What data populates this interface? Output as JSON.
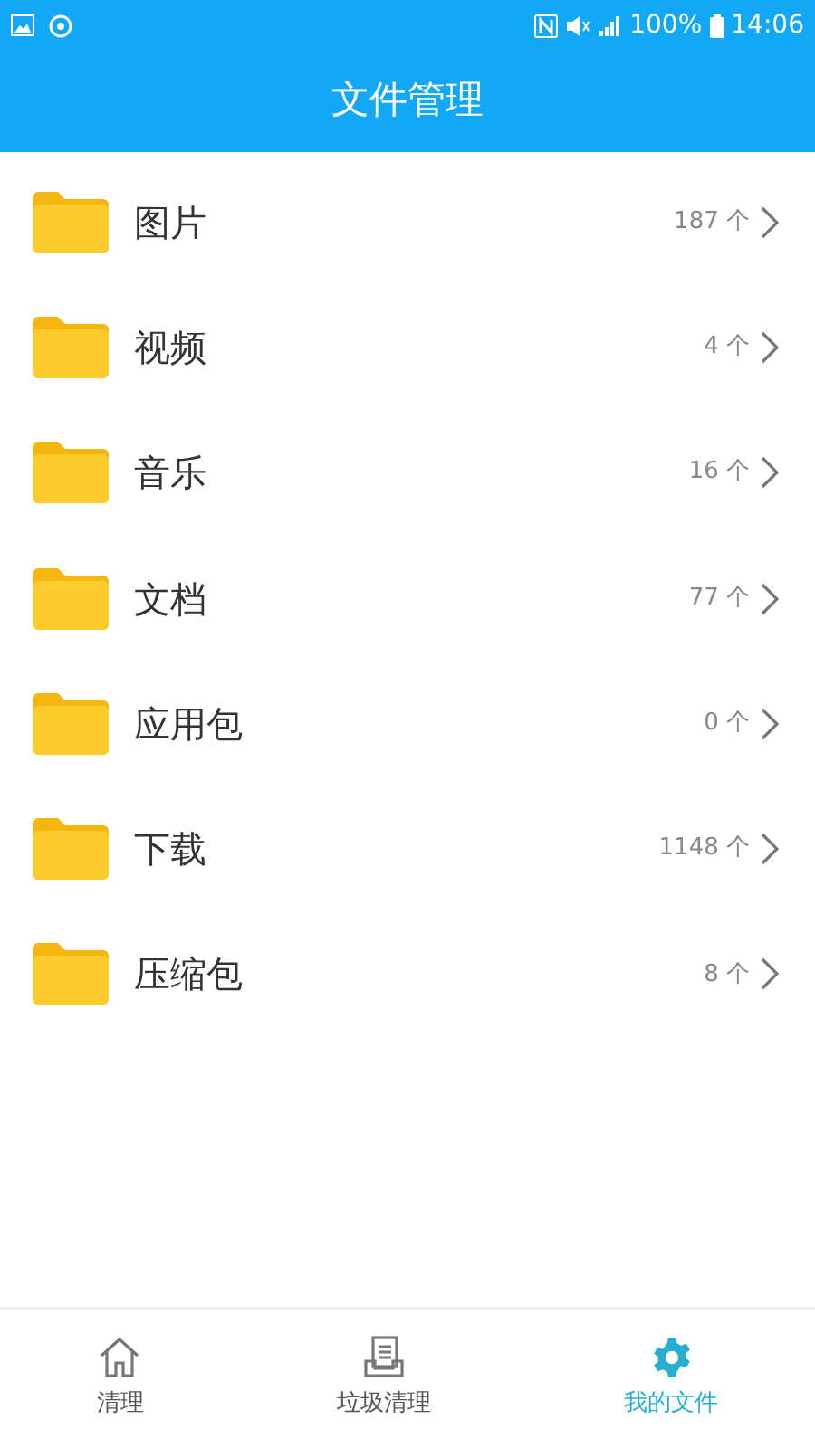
{
  "status_bar": {
    "battery": "100%",
    "time": "14:06"
  },
  "title": "文件管理",
  "folders": [
    {
      "name": "图片",
      "count": "187 个"
    },
    {
      "name": "视频",
      "count": "4 个"
    },
    {
      "name": "音乐",
      "count": "16 个"
    },
    {
      "name": "文档",
      "count": "77 个"
    },
    {
      "name": "应用包",
      "count": "0 个"
    },
    {
      "name": "下载",
      "count": "1148 个"
    },
    {
      "name": "压缩包",
      "count": "8 个"
    }
  ],
  "tabs": [
    {
      "label": "清理",
      "kind": "home",
      "selected": false
    },
    {
      "label": "垃圾清理",
      "kind": "doc",
      "selected": false
    },
    {
      "label": "我的文件",
      "kind": "gear",
      "selected": true
    }
  ]
}
